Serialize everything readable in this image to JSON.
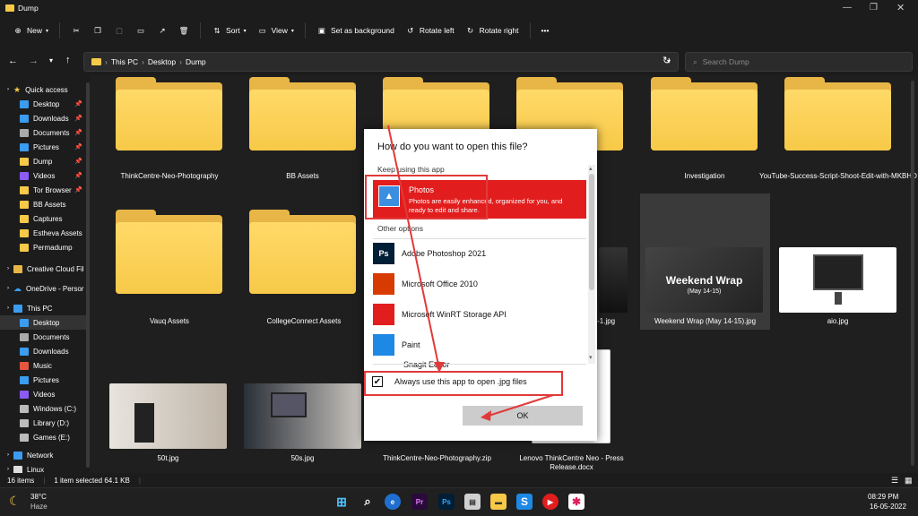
{
  "window": {
    "title": "Dump"
  },
  "toolbar": {
    "new": "New",
    "sort": "Sort",
    "view": "View",
    "set_bg": "Set as background",
    "rot_left": "Rotate left",
    "rot_right": "Rotate right",
    "more": "•••"
  },
  "address": {
    "crumbs": [
      "This PC",
      "Desktop",
      "Dump"
    ],
    "search_placeholder": "Search Dump"
  },
  "sidebar": {
    "quick_access": "Quick access",
    "qa_items": [
      {
        "label": "Desktop",
        "pinned": true
      },
      {
        "label": "Downloads",
        "pinned": true
      },
      {
        "label": "Documents",
        "pinned": true
      },
      {
        "label": "Pictures",
        "pinned": true
      },
      {
        "label": "Dump",
        "pinned": true
      },
      {
        "label": "Videos",
        "pinned": true
      },
      {
        "label": "Tor Browser",
        "pinned": true
      },
      {
        "label": "BB Assets"
      },
      {
        "label": "Captures"
      },
      {
        "label": "Estheva Assets"
      },
      {
        "label": "Permadump"
      }
    ],
    "creative_cloud": "Creative Cloud Fil",
    "onedrive": "OneDrive - Persor",
    "this_pc": "This PC",
    "pc_items": [
      "Desktop",
      "Documents",
      "Downloads",
      "Music",
      "Pictures",
      "Videos",
      "Windows (C:)",
      "Library (D:)",
      "Games (E:)"
    ],
    "network": "Network",
    "linux": "Linux"
  },
  "files": [
    {
      "name": "ThinkCentre-Neo-Photography",
      "type": "folder"
    },
    {
      "name": "BB Assets",
      "type": "folder"
    },
    {
      "name": "",
      "type": "folder"
    },
    {
      "name": "",
      "type": "folder"
    },
    {
      "name": "Investigation",
      "type": "folder"
    },
    {
      "name": "YouTube-Success-Script-Shoot-Edit-with-MKBHD",
      "type": "folder"
    },
    {
      "name": "Vauq Assets",
      "type": "folder"
    },
    {
      "name": "CollegeConnect Assets",
      "type": "folder"
    },
    {
      "name": "ows-1.jpg",
      "type": "image"
    },
    {
      "name": "Weekend Wrap (May 14-15).jpg",
      "type": "image"
    },
    {
      "name": "aio.jpg",
      "type": "image"
    },
    {
      "name": "50t.jpg",
      "type": "image"
    },
    {
      "name": "50s.jpg",
      "type": "image"
    },
    {
      "name": "ThinkCentre-Neo-Photography.zip",
      "type": "zip"
    },
    {
      "name": "Lenovo ThinkCentre Neo - Press Release.docx",
      "type": "docx"
    }
  ],
  "thumb_text": {
    "weekend_title": "Weekend Wrap",
    "weekend_sub": "(May 14-15)"
  },
  "dialog": {
    "title": "How do you want to open this file?",
    "keep_using": "Keep using this app",
    "photos_name": "Photos",
    "photos_desc": "Photos are easily enhanced, organized for you, and ready to edit and share.",
    "other_options": "Other options",
    "apps": [
      {
        "name": "Adobe Photoshop 2021",
        "icon": "Ps",
        "color": "#001e36"
      },
      {
        "name": "Microsoft Office 2010",
        "icon": "office-icon",
        "color": "#d83b01"
      },
      {
        "name": "Microsoft WinRT Storage API",
        "icon": "file-icon",
        "color": "#e21d1d"
      },
      {
        "name": "Paint",
        "icon": "paint-icon",
        "color": "#1e88e5"
      },
      {
        "name": "Snagit Editor",
        "icon": "snagit-icon",
        "color": "#3a6fd8"
      }
    ],
    "always_label": "Always use this app to open .jpg files",
    "always_checked": true,
    "ok": "OK"
  },
  "status": {
    "items": "16 items",
    "selected": "1 item selected  64.1 KB"
  },
  "taskbar": {
    "temp": "38°C",
    "weather": "Haze",
    "time": "08:29 PM",
    "date": "16-05-2022"
  },
  "colors": {
    "accent": "#e21d1d",
    "folder": "#f7c948",
    "annotation": "#e13a3a"
  }
}
